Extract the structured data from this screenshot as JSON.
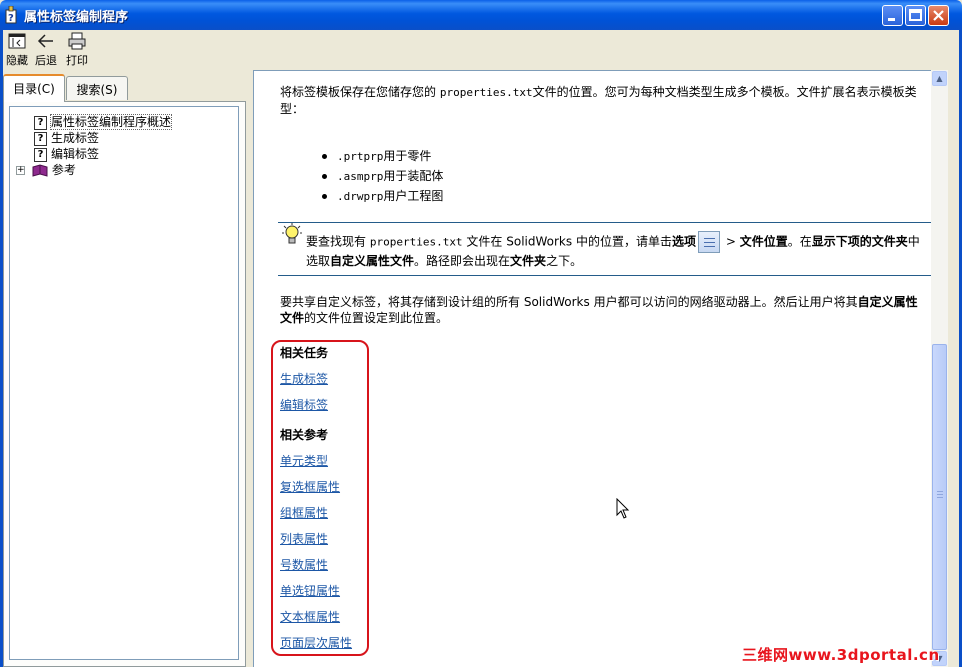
{
  "window": {
    "title": "属性标签编制程序"
  },
  "toolbar": {
    "hide_label": "隐藏",
    "back_label": "后退",
    "print_label": "打印"
  },
  "tabs": {
    "contents": "目录(C)",
    "search": "搜索(S)"
  },
  "tree": {
    "items": [
      {
        "label": "属性标签编制程序概述",
        "icon": "help-page-icon"
      },
      {
        "label": "生成标签",
        "icon": "help-page-icon"
      },
      {
        "label": "编辑标签",
        "icon": "help-page-icon"
      },
      {
        "label": "参考",
        "icon": "book-icon",
        "expander": "+"
      }
    ]
  },
  "content": {
    "intro_part1": "将标签模板保存在您储存您的",
    "intro_file": "properties.txt",
    "intro_part2": "文件的位置。您可为每种文档类型生成多个模板。文件扩展名表示模板类型：",
    "bullets": [
      {
        "ext": ".prtprp",
        "text": "用于零件"
      },
      {
        "ext": ".asmprp",
        "text": "用于装配体"
      },
      {
        "ext": ".drwprp",
        "text": "用户工程图"
      }
    ],
    "note": {
      "p1": "要查找现有",
      "file": "properties.txt",
      "p2": "文件在",
      "app": "SolidWorks",
      "p3": "中的位置，请单击",
      "opt": "选项",
      "p4": ">",
      "fileloc": "文件位置",
      "p5": "。在",
      "show": "显示下项的文件夹",
      "p6": "中选取",
      "custom": "自定义属性文件",
      "p7": "。路径即会出现在",
      "folder": "文件夹",
      "p8": "之下。"
    },
    "share": {
      "p1": "要共享自定义标签，将其存储到设计组的所有",
      "app": "SolidWorks",
      "p2": "用户都可以访问的网络驱动器上。然后让用户将其",
      "custom": "自定义属性文件",
      "p3": "的文件位置设定到此位置。"
    },
    "related_tasks_heading": "相关任务",
    "related_tasks": [
      "生成标签",
      "编辑标签"
    ],
    "related_refs_heading": "相关参考",
    "related_refs": [
      "单元类型",
      "复选框属性",
      "组框属性",
      "列表属性",
      "号数属性",
      "单选钮属性",
      "文本框属性",
      "页面层次属性"
    ]
  },
  "watermark": "三维网www.3dportal.cn",
  "colors": {
    "titlebar": "#0054E3",
    "link": "#1D57A6",
    "highlight_box": "#D7141B",
    "watermark": "#E8151D"
  }
}
